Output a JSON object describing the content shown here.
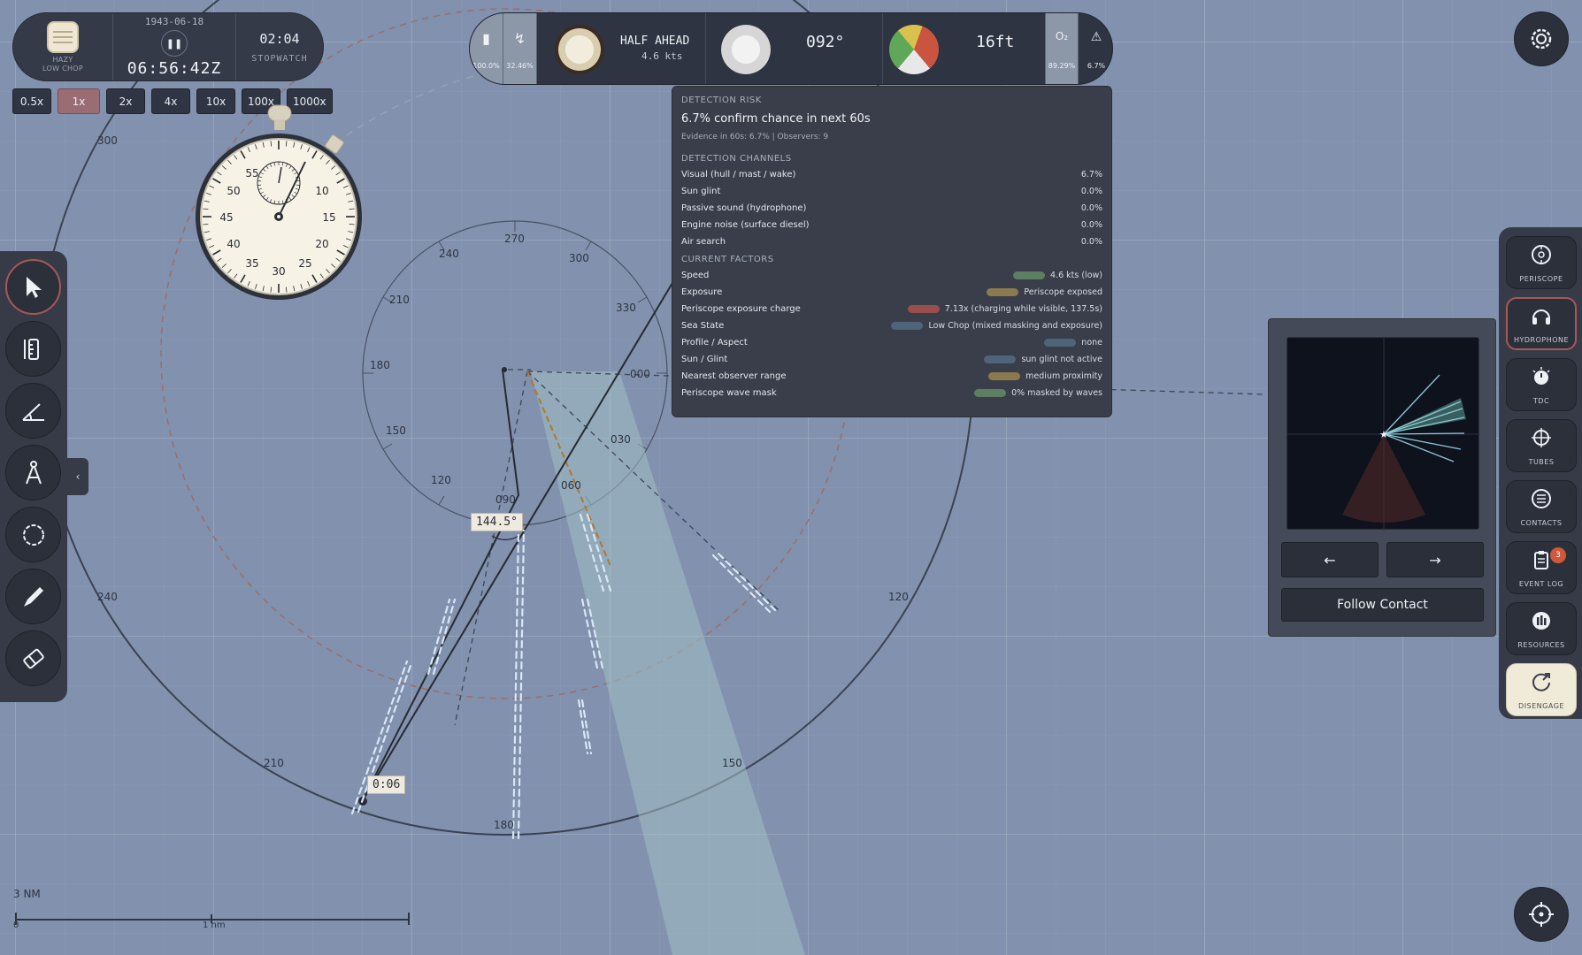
{
  "time_panel": {
    "weather_line1": "HAZY",
    "weather_line2": "LOW CHOP",
    "date": "1943-06-18",
    "time": "06:56:42Z",
    "stopwatch_time": "02:04",
    "stopwatch_label": "STOPWATCH",
    "pause_icon": "pause-icon"
  },
  "speed_buttons": [
    {
      "label": "0.5x",
      "active": false
    },
    {
      "label": "1x",
      "active": true
    },
    {
      "label": "2x",
      "active": false
    },
    {
      "label": "4x",
      "active": false
    },
    {
      "label": "10x",
      "active": false
    },
    {
      "label": "100x",
      "active": false
    },
    {
      "label": "1000x",
      "active": false
    }
  ],
  "stopwatch_dial": {
    "outer_numbers": [
      "50",
      "55",
      "10",
      "15",
      "20",
      "25",
      "30",
      "35",
      "40",
      "45"
    ]
  },
  "status_bar": {
    "battery_value": "100.0%",
    "charge_value": "32.46%",
    "telegraph_order": "HALF AHEAD",
    "telegraph_speed": "4.6 kts",
    "heading": "092°",
    "depth": "16ft",
    "oxygen_symbol": "O₂",
    "oxygen_value": "89.29%",
    "alert_value": "6.7%",
    "accent_color": "#8c97a8"
  },
  "detection": {
    "header": "DETECTION RISK",
    "confirm_text": "6.7% confirm chance in next 60s",
    "evidence_text": "Evidence in 60s: 6.7% | Observers: 9",
    "channels_header": "DETECTION CHANNELS",
    "channels": [
      {
        "label": "Visual (hull / mast / wake)",
        "value": "6.7%"
      },
      {
        "label": "Sun glint",
        "value": "0.0%"
      },
      {
        "label": "Passive sound (hydrophone)",
        "value": "0.0%"
      },
      {
        "label": "Engine noise (surface diesel)",
        "value": "0.0%"
      },
      {
        "label": "Air search",
        "value": "0.0%"
      }
    ],
    "factors_header": "CURRENT FACTORS",
    "factors": [
      {
        "label": "Speed",
        "value": "4.6 kts (low)",
        "chip": "#5e7e62"
      },
      {
        "label": "Exposure",
        "value": "Periscope exposed",
        "chip": "#8a7a4e"
      },
      {
        "label": "Periscope exposure charge",
        "value": "7.13x (charging while visible, 137.5s)",
        "chip": "#9a4e4e"
      },
      {
        "label": "Sea State",
        "value": "Low Chop (mixed masking and exposure)",
        "chip": "#4e6478"
      },
      {
        "label": "Profile / Aspect",
        "value": "none",
        "chip": "#4e6478"
      },
      {
        "label": "Sun / Glint",
        "value": "sun glint not active",
        "chip": "#4e6478"
      },
      {
        "label": "Nearest observer range",
        "value": "medium proximity",
        "chip": "#8a7a4e"
      },
      {
        "label": "Periscope wave mask",
        "value": "0% masked by waves",
        "chip": "#5e7e62"
      }
    ]
  },
  "tools": [
    {
      "name": "select-icon",
      "active": true
    },
    {
      "name": "ruler-icon",
      "active": false
    },
    {
      "name": "protractor-icon",
      "active": false
    },
    {
      "name": "compass-icon",
      "active": false
    },
    {
      "name": "circle-icon",
      "active": false
    },
    {
      "name": "pencil-icon",
      "active": false
    },
    {
      "name": "eraser-icon",
      "active": false
    }
  ],
  "collapse_icon": "chevron-left-icon",
  "stations": [
    {
      "label": "PERISCOPE",
      "icon": "periscope-icon",
      "active": false
    },
    {
      "label": "HYDROPHONE",
      "icon": "headphones-icon",
      "active": true
    },
    {
      "label": "TDC",
      "icon": "dial-icon",
      "active": false
    },
    {
      "label": "TUBES",
      "icon": "crosshair-icon",
      "active": false
    },
    {
      "label": "CONTACTS",
      "icon": "list-icon",
      "active": false
    },
    {
      "label": "EVENT LOG",
      "icon": "clipboard-icon",
      "active": false
    },
    {
      "label": "RESOURCES",
      "icon": "bars-icon",
      "active": false
    },
    {
      "label": "DISENGAGE",
      "icon": "disengage-icon",
      "active": false
    }
  ],
  "event_log_badge": "3",
  "hydrophone": {
    "prev_label": "←",
    "next_label": "→",
    "follow_label": "Follow Contact"
  },
  "map": {
    "outer_ring_labels": [
      "300",
      "240",
      "210",
      "180",
      "150",
      "120"
    ],
    "inner_ring_labels": [
      "270",
      "300",
      "330",
      "240",
      "210",
      "180",
      "000",
      "150",
      "030",
      "120",
      "090",
      "060"
    ],
    "angle_label": "144.5°",
    "time_label": "0:06",
    "scale_title": "3 NM",
    "scale_zero": "0",
    "scale_mid": "1 nm"
  }
}
